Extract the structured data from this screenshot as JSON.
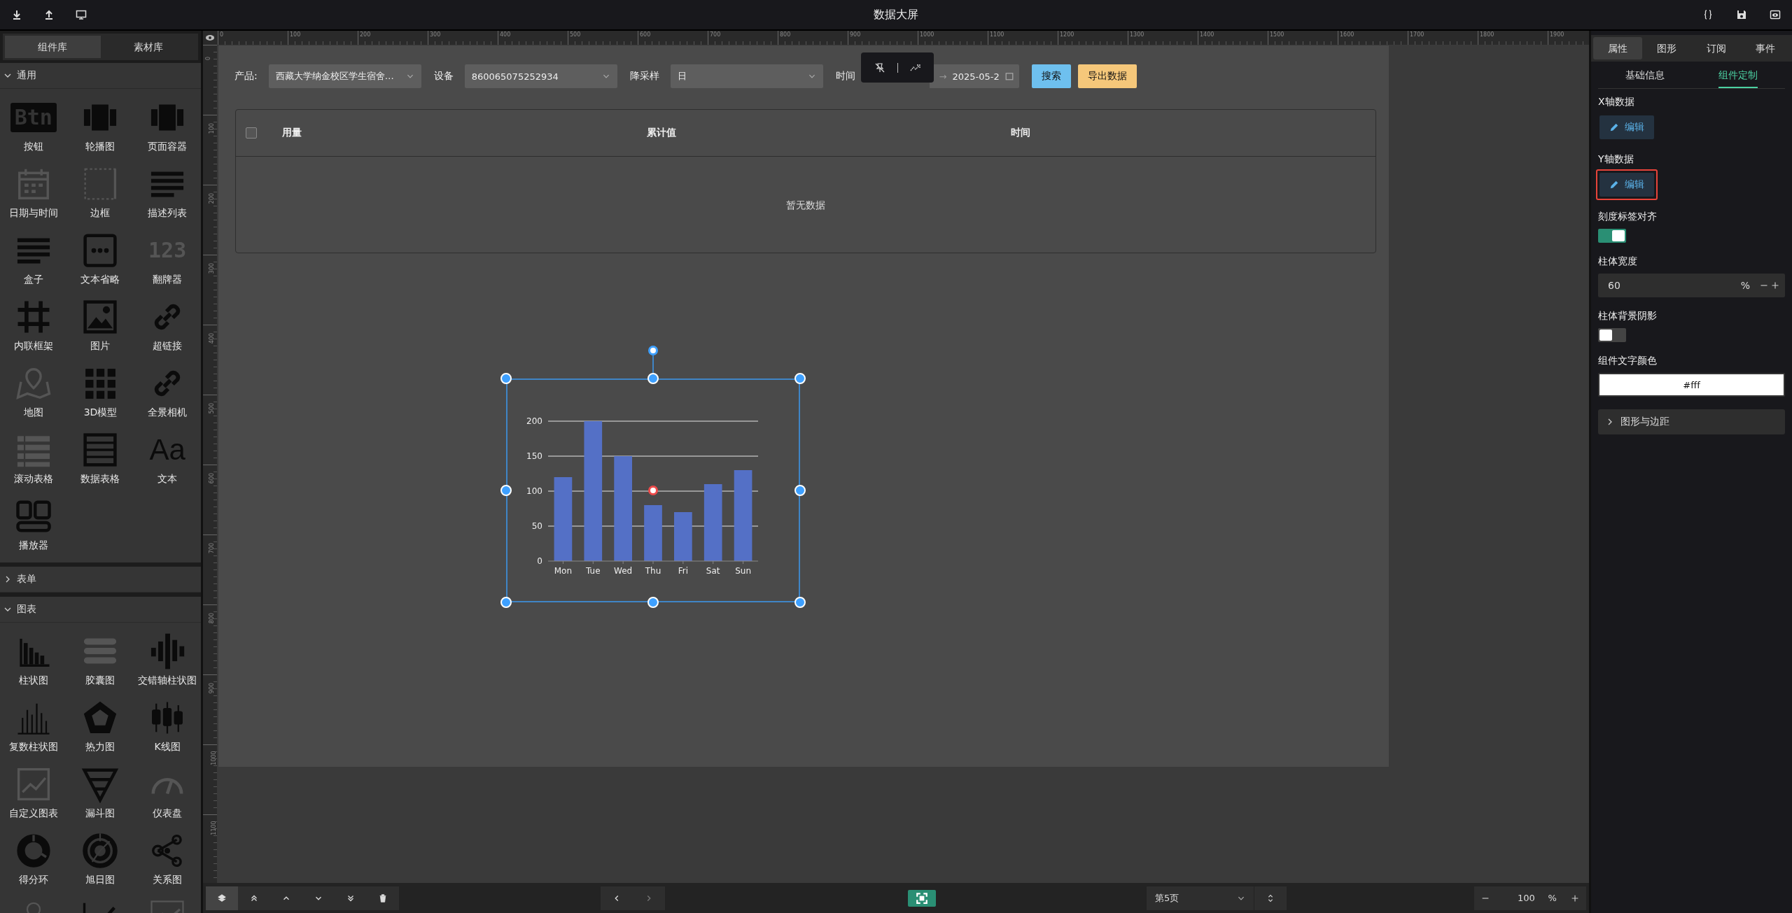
{
  "top_bar": {
    "title": "数据大屏"
  },
  "left_panel": {
    "tabs": [
      {
        "label": "组件库",
        "selected": true
      },
      {
        "label": "素材库",
        "selected": false
      }
    ],
    "sections": [
      {
        "title": "通用",
        "expanded": true,
        "items": [
          {
            "kind": "tile",
            "label": "按钮",
            "icon_text": "Btn"
          },
          {
            "kind": "tile",
            "label": "轮播图"
          },
          {
            "kind": "tile",
            "label": "页面容器"
          },
          {
            "kind": "tile",
            "label": "日期与时间"
          },
          {
            "kind": "tile",
            "label": "边框"
          },
          {
            "kind": "tile",
            "label": "描述列表"
          },
          {
            "kind": "tile",
            "label": "盒子"
          },
          {
            "kind": "tile",
            "label": "文本省略"
          },
          {
            "kind": "tile",
            "label": "翻牌器",
            "icon_text": "123"
          },
          {
            "kind": "tile",
            "label": "内联框架"
          },
          {
            "kind": "tile",
            "label": "图片"
          },
          {
            "kind": "tile",
            "label": "超链接"
          },
          {
            "kind": "tile",
            "label": "地图"
          },
          {
            "kind": "tile",
            "label": "3D模型"
          },
          {
            "kind": "tile",
            "label": "全景相机"
          },
          {
            "kind": "tile",
            "label": "滚动表格"
          },
          {
            "kind": "tile",
            "label": "数据表格"
          },
          {
            "kind": "tile",
            "label": "文本",
            "icon_text": "Aa"
          },
          {
            "kind": "tile",
            "label": "播放器"
          }
        ]
      },
      {
        "title": "表单",
        "expanded": false
      },
      {
        "title": "图表",
        "expanded": true,
        "items": [
          {
            "kind": "tile",
            "label": "柱状图"
          },
          {
            "kind": "tile",
            "label": "胶囊图"
          },
          {
            "kind": "tile",
            "label": "交错轴柱状图"
          },
          {
            "kind": "tile",
            "label": "复数柱状图"
          },
          {
            "kind": "tile",
            "label": "热力图"
          },
          {
            "kind": "tile",
            "label": "K线图"
          },
          {
            "kind": "tile",
            "label": "自定义图表"
          },
          {
            "kind": "tile",
            "label": "漏斗图"
          },
          {
            "kind": "tile",
            "label": "仪表盘"
          },
          {
            "kind": "tile",
            "label": "得分环"
          },
          {
            "kind": "tile",
            "label": "旭日图"
          },
          {
            "kind": "tile",
            "label": "关系图"
          },
          {
            "kind": "partial"
          },
          {
            "kind": "partial"
          },
          {
            "kind": "partial"
          }
        ]
      }
    ]
  },
  "rulers": {
    "horizontal": [
      "0",
      "100",
      "200",
      "300",
      "400",
      "500",
      "600",
      "700",
      "800",
      "900",
      "1000",
      "1100",
      "1200",
      "1300",
      "1400",
      "1500",
      "1600",
      "1700",
      "1800",
      "1900"
    ],
    "vertical": [
      "0",
      "100",
      "200",
      "300",
      "400",
      "500",
      "600",
      "700",
      "800",
      "900",
      "1000",
      "1100"
    ]
  },
  "filters": [
    {
      "kind": "select",
      "label": "产品:",
      "value": "西藏大学纳金校区学生宿舍…"
    },
    {
      "kind": "select",
      "label": "设备",
      "value": "860065075252934"
    },
    {
      "kind": "select",
      "label": "降采样",
      "value": "日"
    },
    {
      "kind": "date",
      "label": "时间",
      "separator": "→",
      "value": "2025-05-2"
    }
  ],
  "filter_buttons": [
    {
      "label": "搜索",
      "kind": "primary"
    },
    {
      "label": "导出数据",
      "kind": "warning"
    }
  ],
  "table": {
    "select_all": {
      "checked": false
    },
    "columns": [
      "用量",
      "累计值",
      "时间"
    ],
    "empty_text": "暂无数据"
  },
  "chart_data": {
    "type": "bar",
    "categories": [
      "Mon",
      "Tue",
      "Wed",
      "Thu",
      "Fri",
      "Sat",
      "Sun"
    ],
    "values": [
      120,
      200,
      150,
      80,
      70,
      110,
      130
    ],
    "ylim": [
      0,
      200
    ],
    "yticks": [
      0,
      50,
      100,
      150,
      200
    ],
    "grid": true
  },
  "right_panel": {
    "tabs": [
      {
        "label": "属性",
        "selected": true
      },
      {
        "label": "图形",
        "selected": false
      },
      {
        "label": "订阅",
        "selected": false
      },
      {
        "label": "事件",
        "selected": false
      }
    ],
    "subtabs": [
      {
        "label": "基础信息",
        "selected": false
      },
      {
        "label": "组件定制",
        "selected": true
      }
    ],
    "fields": [
      {
        "kind": "button",
        "label": "X轴数据",
        "button": "编辑",
        "highlighted": false
      },
      {
        "kind": "button",
        "label": "Y轴数据",
        "button": "编辑",
        "highlighted": true
      },
      {
        "kind": "switch",
        "label": "刻度标签对齐",
        "on": true
      },
      {
        "kind": "number",
        "label": "柱体宽度",
        "value": "60",
        "unit": "%"
      },
      {
        "kind": "switch",
        "label": "柱体背景阴影",
        "on": false
      },
      {
        "kind": "color",
        "label": "组件文字颜色",
        "value": "#fff"
      }
    ],
    "collapse": {
      "label": "图形与边距",
      "expanded": false
    }
  },
  "bottom_bar": {
    "layers_selected": true,
    "page": "第5页",
    "zoom": "100",
    "zoom_unit": "%"
  }
}
